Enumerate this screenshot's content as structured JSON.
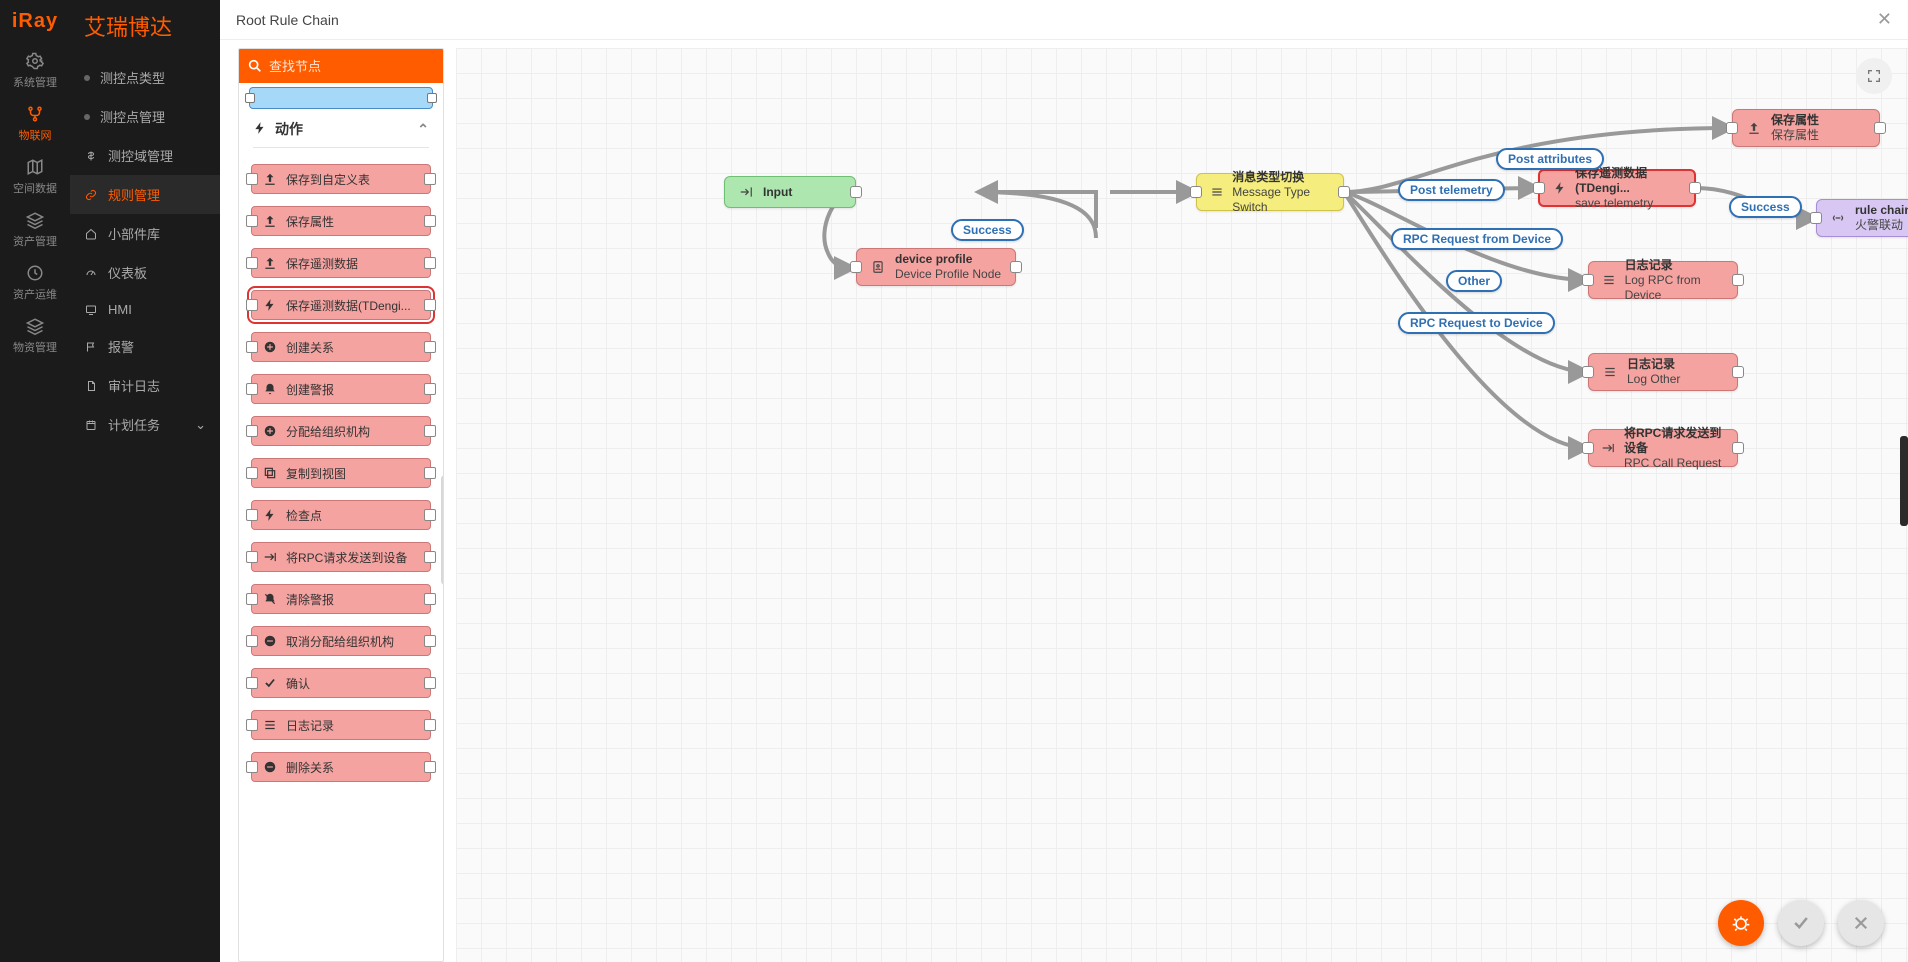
{
  "brand": {
    "logo": "iRay",
    "name": "艾瑞博达"
  },
  "leftbar": [
    {
      "icon": "gear",
      "label": "系统管理"
    },
    {
      "icon": "fork",
      "label": "物联网",
      "active": true
    },
    {
      "icon": "map",
      "label": "空间数据"
    },
    {
      "icon": "layers",
      "label": "资产管理"
    },
    {
      "icon": "clock",
      "label": "资产运维"
    },
    {
      "icon": "layers",
      "label": "物资管理"
    }
  ],
  "side2": [
    {
      "bullet": true,
      "label": "测控点类型"
    },
    {
      "bullet": true,
      "label": "测控点管理"
    },
    {
      "icon": "dollar",
      "label": "测控域管理"
    },
    {
      "icon": "link",
      "label": "规则管理",
      "active": true
    },
    {
      "icon": "home",
      "label": "小部件库"
    },
    {
      "icon": "gauge",
      "label": "仪表板"
    },
    {
      "icon": "screen",
      "label": "HMI"
    },
    {
      "icon": "flag",
      "label": "报警"
    },
    {
      "icon": "doc",
      "label": "审计日志"
    },
    {
      "icon": "cal",
      "label": "计划任务",
      "chevron": true
    }
  ],
  "header": {
    "title": "Root Rule Chain"
  },
  "palette": {
    "search_placeholder": "查找节点",
    "section_title": "动作",
    "items": [
      {
        "icon": "upload",
        "label": "保存到自定义表"
      },
      {
        "icon": "upload",
        "label": "保存属性"
      },
      {
        "icon": "upload",
        "label": "保存遥测数据"
      },
      {
        "icon": "bolt",
        "label": "保存遥测数据(TDengi...",
        "highlight": true
      },
      {
        "icon": "plus",
        "label": "创建关系"
      },
      {
        "icon": "bell",
        "label": "创建警报"
      },
      {
        "icon": "plus",
        "label": "分配给组织机构"
      },
      {
        "icon": "copy",
        "label": "复制到视图"
      },
      {
        "icon": "bolt",
        "label": "检查点"
      },
      {
        "icon": "send",
        "label": "将RPC请求发送到设备"
      },
      {
        "icon": "bellx",
        "label": "清除警报"
      },
      {
        "icon": "minus",
        "label": "取消分配给组织机构"
      },
      {
        "icon": "check",
        "label": "确认"
      },
      {
        "icon": "list",
        "label": "日志记录"
      },
      {
        "icon": "minus",
        "label": "删除关系"
      }
    ]
  },
  "canvas": {
    "nodes": {
      "input": {
        "title": "Input"
      },
      "switch": {
        "title": "消息类型切换",
        "sub": "Message Type Switch"
      },
      "profile": {
        "title": "device profile",
        "sub": "Device Profile Node"
      },
      "attrs": {
        "title": "保存属性",
        "sub": "保存属性"
      },
      "tdengi": {
        "title": "保存遥测数据(TDengi...",
        "sub": "save telemetry"
      },
      "logrpc": {
        "title": "日志记录",
        "sub": "Log RPC from Device"
      },
      "logoth": {
        "title": "日志记录",
        "sub": "Log Other"
      },
      "rpcreq": {
        "title": "将RPC请求发送到设备",
        "sub": "RPC Call Request"
      },
      "chain": {
        "title": "rule chain",
        "sub": "火警联动"
      }
    },
    "labels": {
      "success1": "Success",
      "postattr": "Post attributes",
      "posttel": "Post telemetry",
      "rpcfrom": "RPC Request from Device",
      "other": "Other",
      "rpcto": "RPC Request to Device",
      "success2": "Success"
    }
  },
  "colors": {
    "accent": "#ff5c00",
    "edge_label_border": "#2f6fb3"
  }
}
